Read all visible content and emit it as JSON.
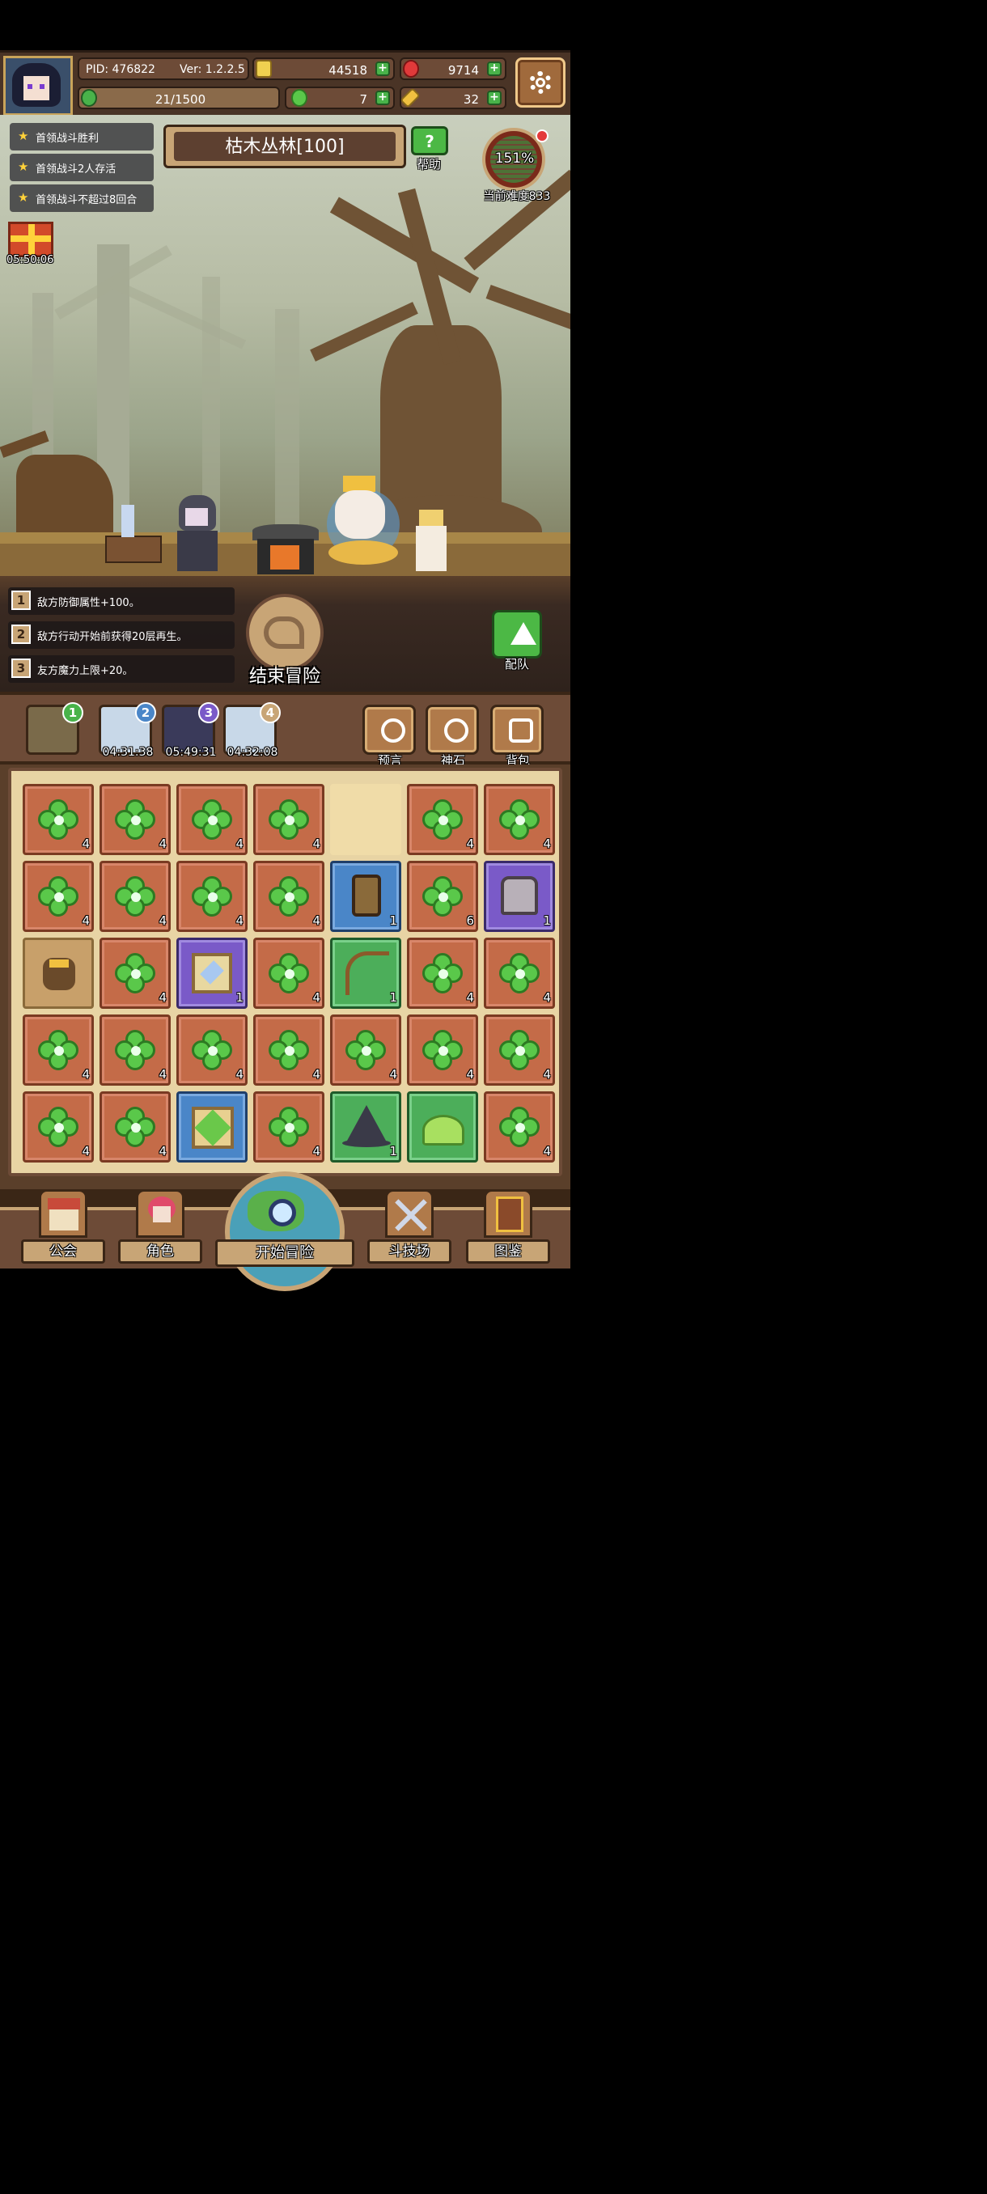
{
  "header": {
    "pid": "PID: 476822",
    "version": "Ver: 1.2.2.5",
    "gold": "44518",
    "gems": "9714",
    "stamina": "21/1500",
    "clovers": "7",
    "keys": "32"
  },
  "quests": [
    {
      "label": "首领战斗胜利"
    },
    {
      "label": "首领战斗2人存活"
    },
    {
      "label": "首领战斗不超过8回合"
    }
  ],
  "gift_timer": "05:50:06",
  "stage_title": "枯木丛林[100]",
  "help_label": "帮助",
  "difficulty": {
    "percent": "151%",
    "label": "当前难度833"
  },
  "effects": [
    {
      "num": "1",
      "text": "敌方防御属性+100。"
    },
    {
      "num": "2",
      "text": "敌方行动开始前获得20层再生。"
    },
    {
      "num": "3",
      "text": "友方魔力上限+20。"
    }
  ],
  "end_button": "结束冒险",
  "team_button": "配队",
  "maps": [
    {
      "badge": "1",
      "timer": "",
      "color": "#7a6a4a",
      "badge_color": "#49b34a"
    },
    {
      "badge": "2",
      "timer": "04:31:38",
      "color": "#c8d8e8",
      "badge_color": "#4a86c8"
    },
    {
      "badge": "3",
      "timer": "05:49:31",
      "color": "#3a3a5a",
      "badge_color": "#7a5ac8"
    },
    {
      "badge": "4",
      "timer": "04:32:08",
      "color": "#c8d8e8",
      "badge_color": "#c8a576"
    }
  ],
  "side_buttons": {
    "prophecy": "预言",
    "godstone": "神石",
    "bag": "背包"
  },
  "inventory": [
    [
      "clover:4",
      "clover:4",
      "clover:4",
      "clover:4",
      "empty",
      "clover:4",
      "clover:4"
    ],
    [
      "clover:4",
      "clover:4",
      "clover:4",
      "clover:4",
      "shield:1",
      "clover:6",
      "armor:1"
    ],
    [
      "stump:",
      "clover:4",
      "crystal:1",
      "clover:4",
      "bow:1",
      "clover:4",
      "clover:4"
    ],
    [
      "clover:4",
      "clover:4",
      "clover:4",
      "clover:4",
      "clover:4",
      "clover:4",
      "clover:4"
    ],
    [
      "clover:4",
      "clover:4",
      "gem:",
      "clover:4",
      "hat:1",
      "slime:",
      "clover:4"
    ]
  ],
  "nav": {
    "guild": "公会",
    "character": "角色",
    "start": "开始冒险",
    "arena": "斗技场",
    "codex": "图鉴"
  }
}
